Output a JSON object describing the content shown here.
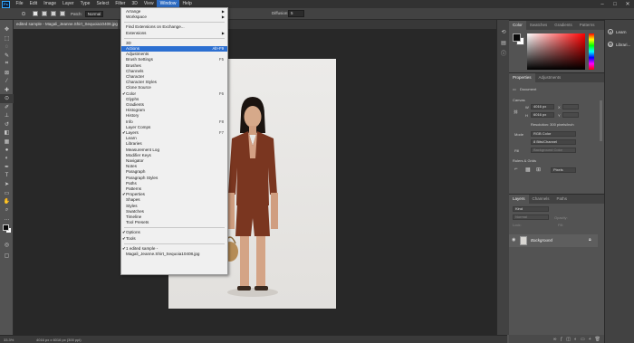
{
  "menubar": {
    "logo": "Ps",
    "items": [
      "File",
      "Edit",
      "Image",
      "Layer",
      "Type",
      "Select",
      "Filter",
      "3D",
      "View",
      "Window",
      "Help"
    ],
    "active_item": "Window"
  },
  "options_bar": {
    "mode_label": "Patch:",
    "mode_value": "Normal",
    "feather_label": "Diffusion:",
    "feather_value": "5"
  },
  "document_tab": {
    "title": "edited sample - Magali_Jeanne.Shirt_Sequoia10408.jpg"
  },
  "status_bar": {
    "zoom": "33.3%",
    "doc_info": "4016 px x 6016 px (300 ppi)"
  },
  "window_menu": {
    "groups": [
      [
        {
          "label": "Arrange",
          "submenu": true
        },
        {
          "label": "Workspace",
          "submenu": true
        }
      ],
      [
        {
          "label": "Find Extensions on Exchange..."
        },
        {
          "label": "Extensions",
          "submenu": true
        }
      ],
      [
        {
          "label": "3D"
        },
        {
          "label": "Actions",
          "shortcut": "Alt+F9",
          "highlighted": true
        },
        {
          "label": "Adjustments"
        },
        {
          "label": "Brush Settings",
          "shortcut": "F5"
        },
        {
          "label": "Brushes"
        },
        {
          "label": "Channels"
        },
        {
          "label": "Character"
        },
        {
          "label": "Character Styles"
        },
        {
          "label": "Clone Source"
        },
        {
          "label": "Color",
          "shortcut": "F6",
          "checked": true
        },
        {
          "label": "Glyphs"
        },
        {
          "label": "Gradients"
        },
        {
          "label": "Histogram"
        },
        {
          "label": "History"
        },
        {
          "label": "Info",
          "shortcut": "F8"
        },
        {
          "label": "Layer Comps"
        },
        {
          "label": "Layers",
          "shortcut": "F7",
          "checked": true
        },
        {
          "label": "Learn"
        },
        {
          "label": "Libraries"
        },
        {
          "label": "Measurement Log"
        },
        {
          "label": "Modifier Keys"
        },
        {
          "label": "Navigator"
        },
        {
          "label": "Notes"
        },
        {
          "label": "Paragraph"
        },
        {
          "label": "Paragraph Styles"
        },
        {
          "label": "Paths"
        },
        {
          "label": "Patterns"
        },
        {
          "label": "Properties",
          "checked": true
        },
        {
          "label": "Shapes"
        },
        {
          "label": "Styles"
        },
        {
          "label": "Swatches"
        },
        {
          "label": "Timeline"
        },
        {
          "label": "Tool Presets"
        }
      ],
      [
        {
          "label": "Options",
          "checked": true
        },
        {
          "label": "Tools",
          "checked": true
        }
      ],
      [
        {
          "label": "1 edited sample - Magali_Jeanne.Shirt_Sequoia10408.jpg",
          "checked": true
        }
      ]
    ]
  },
  "color_panel": {
    "tabs": [
      "Color",
      "Swatches",
      "Gradients",
      "Patterns"
    ],
    "active_tab": "Color",
    "foreground": "#0a0a0a",
    "background": "#ffffff"
  },
  "properties_panel": {
    "tabs": [
      "Properties",
      "Adjustments"
    ],
    "active_tab": "Properties",
    "doc_label": "Document",
    "canvas_heading": "Canvas",
    "width_label": "W",
    "width_value": "4016 px",
    "height_label": "H",
    "height_value": "6016 px",
    "x_label": "X",
    "y_label": "Y",
    "resolution": "Resolution: 300 pixels/inch",
    "mode_label": "Mode",
    "mode_value": "RGB Color",
    "bits_value": "8 Bits/Channel",
    "fill_label": "Fill",
    "fill_value": "Background Color",
    "rulers_heading": "Rulers & Grids",
    "units_value": "Pixels"
  },
  "layers_panel": {
    "tabs": [
      "Layers",
      "Channels",
      "Paths"
    ],
    "active_tab": "Layers",
    "filter_kind": "Kind",
    "blend_mode": "Normal",
    "opacity_label": "Opacity:",
    "lock_label": "Lock:",
    "fill_label": "Fill:",
    "layer_name": "Background"
  },
  "far_right": {
    "items": [
      "Learn",
      "Librari..."
    ]
  },
  "colors": {
    "accent": "#2c6fd1",
    "menubar": "#323232",
    "canvas_bg": "#282828",
    "document_bg": "#e9e8e6",
    "shirt": "#7a3620"
  }
}
